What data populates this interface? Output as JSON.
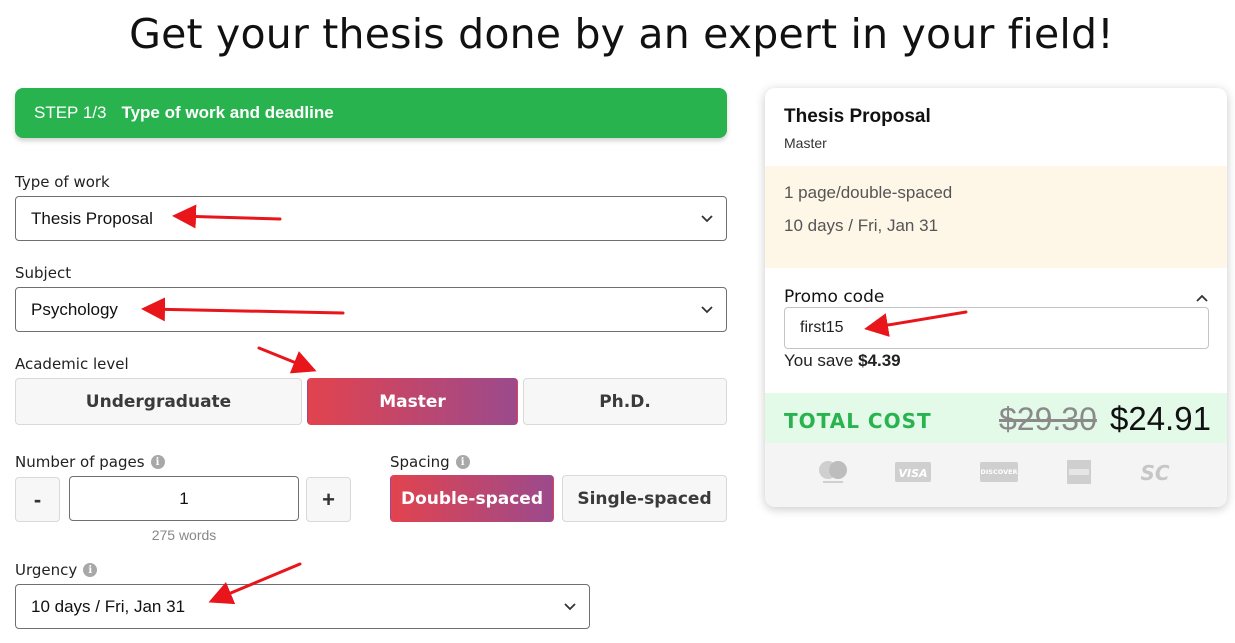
{
  "headline": "Get your thesis done by an expert in your field!",
  "step": {
    "number": "STEP 1/3",
    "title": "Type of work and deadline"
  },
  "form": {
    "type_of_work": {
      "label": "Type of work",
      "value": "Thesis Proposal"
    },
    "subject": {
      "label": "Subject",
      "value": "Psychology"
    },
    "academic_level": {
      "label": "Academic level",
      "options": [
        "Undergraduate",
        "Master",
        "Ph.D."
      ],
      "selected": "Master"
    },
    "pages": {
      "label": "Number of pages",
      "minus": "-",
      "plus": "+",
      "value": "1",
      "words": "275 words"
    },
    "spacing": {
      "label": "Spacing",
      "options": [
        "Double-spaced",
        "Single-spaced"
      ],
      "selected": "Double-spaced"
    },
    "urgency": {
      "label": "Urgency",
      "value": "10 days / Fri, Jan 31"
    }
  },
  "summary": {
    "title": "Thesis Proposal",
    "level": "Master",
    "pages": "1 page/double-spaced",
    "deadline": "10 days / Fri, Jan 31",
    "promo_label": "Promo code",
    "promo_value": "first15",
    "save_prefix": "You save",
    "save_amount": "$4.39",
    "total_label": "TOTAL COST",
    "old_price": "$29.30",
    "new_price": "$24.91",
    "payment_icons": [
      "mastercard-icon",
      "visa-icon",
      "discover-icon",
      "amex-icon",
      "sc-icon"
    ]
  },
  "colors": {
    "green": "#29b34e",
    "gradient_start": "#e2434e",
    "gradient_end": "#9b4a8d",
    "annotation_arrow": "#e8151b"
  }
}
